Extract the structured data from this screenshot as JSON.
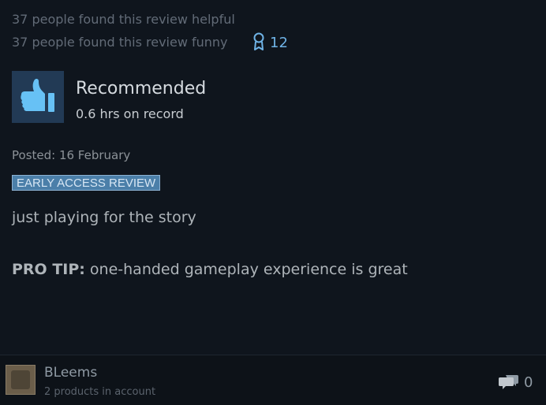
{
  "review": {
    "helpful_text": "37 people found this review helpful",
    "funny_text": "37 people found this review funny",
    "award_icon": "award-ribbon-icon",
    "award_count": "12",
    "recommendation": "Recommended",
    "recommendation_icon": "thumbs-up-icon",
    "hours": "0.6 hrs on record",
    "posted": "Posted: 16 February",
    "badge": "EARLY ACCESS REVIEW",
    "body_line_1": "just playing for the story",
    "protip_label": "PRO TIP:",
    "protip_text": " one-handed gameplay experience is great"
  },
  "author": {
    "name": "BLeems",
    "products": "2 products in account",
    "comment_icon": "comment-bubbles-icon",
    "comment_count": "0"
  },
  "colors": {
    "background": "#0f151d",
    "accent": "#6fb3e6",
    "badge_bg": "#4b7fa9"
  }
}
